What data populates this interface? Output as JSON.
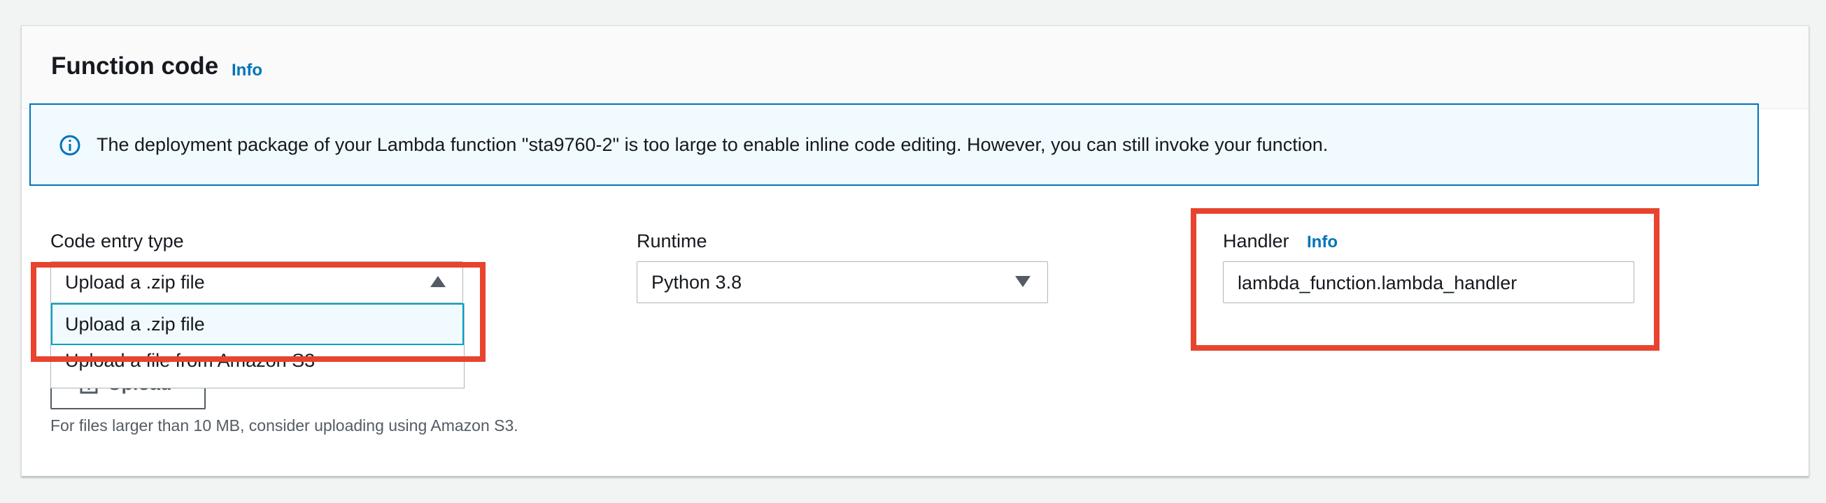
{
  "panel": {
    "title": "Function code",
    "title_info": "Info"
  },
  "alert": {
    "icon": "info-circle-icon",
    "message": "The deployment package of your Lambda function \"sta9760-2\" is too large to enable inline code editing. However, you can still invoke your function."
  },
  "code_entry": {
    "label": "Code entry type",
    "selected": "Upload a .zip file",
    "options": [
      "Upload a .zip file",
      "Upload a file from Amazon S3"
    ]
  },
  "upload": {
    "icon": "upload-icon",
    "label": "Upload",
    "hint": "For files larger than 10 MB, consider uploading using Amazon S3."
  },
  "runtime": {
    "label": "Runtime",
    "selected": "Python 3.8"
  },
  "handler": {
    "label": "Handler",
    "info": "Info",
    "value": "lambda_function.lambda_handler"
  },
  "colors": {
    "link": "#0073bb",
    "alert_bg": "#f1faff",
    "highlight": "#e8432e"
  }
}
